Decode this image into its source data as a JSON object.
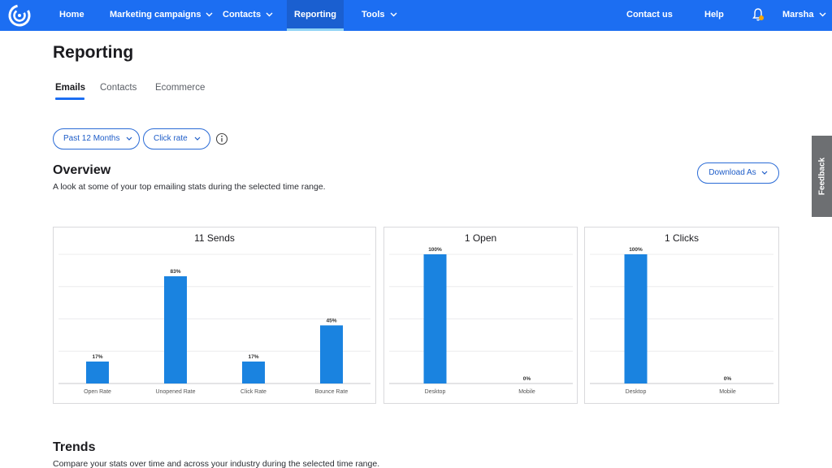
{
  "nav": {
    "home": "Home",
    "marketing": "Marketing campaigns",
    "contacts": "Contacts",
    "reporting": "Reporting",
    "tools": "Tools",
    "contact_us": "Contact us",
    "help": "Help",
    "user": "Marsha",
    "accent_color": "#1c6ef2"
  },
  "page": {
    "title": "Reporting",
    "tabs": [
      "Emails",
      "Contacts",
      "Ecommerce"
    ],
    "active_tab": "Emails"
  },
  "filters": {
    "time_range": "Past 12 Months",
    "metric": "Click rate",
    "info_icon": "info-icon"
  },
  "overview": {
    "title": "Overview",
    "subtitle": "A look at some of your top emailing stats during the selected time range.",
    "download_label": "Download As"
  },
  "feedback": {
    "label": "Feedback"
  },
  "trends": {
    "title": "Trends",
    "subtitle": "Compare your stats over time and across your industry during the selected time range."
  },
  "chart_data": [
    {
      "type": "bar",
      "title": "11 Sends",
      "categories": [
        "Open Rate",
        "Unopened Rate",
        "Click Rate",
        "Bounce Rate"
      ],
      "values": [
        17,
        83,
        17,
        45
      ],
      "labels": [
        "17%",
        "83%",
        "17%",
        "45%"
      ],
      "ylim": [
        0,
        100
      ],
      "grid": true,
      "bar_color": "#1a83e0"
    },
    {
      "type": "bar",
      "title": "1 Open",
      "categories": [
        "Desktop",
        "Mobile"
      ],
      "values": [
        100,
        0
      ],
      "labels": [
        "100%",
        "0%"
      ],
      "ylim": [
        0,
        100
      ],
      "grid": true,
      "bar_color": "#1a83e0"
    },
    {
      "type": "bar",
      "title": "1 Clicks",
      "categories": [
        "Desktop",
        "Mobile"
      ],
      "values": [
        100,
        0
      ],
      "labels": [
        "100%",
        "0%"
      ],
      "ylim": [
        0,
        100
      ],
      "grid": true,
      "bar_color": "#1a83e0"
    }
  ]
}
